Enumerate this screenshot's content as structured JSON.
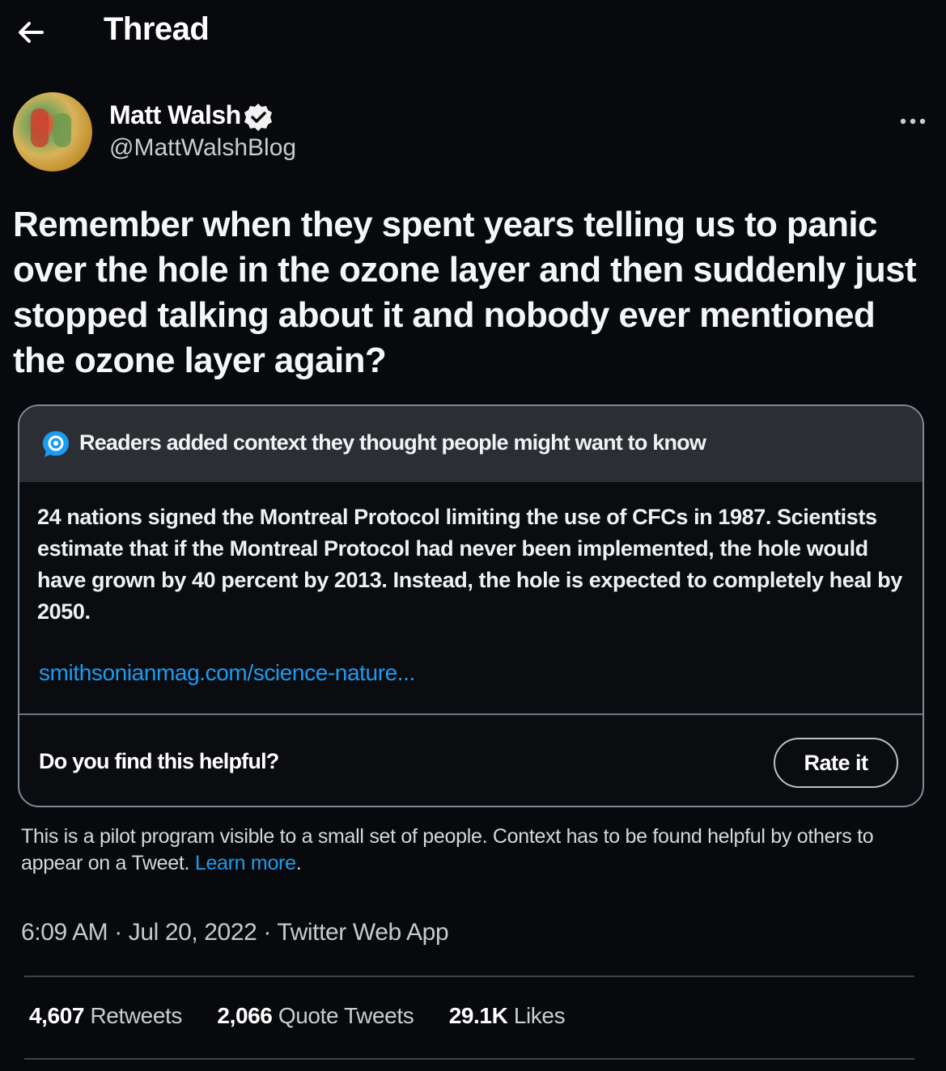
{
  "header": {
    "title": "Thread",
    "back_icon": "arrow-left-icon"
  },
  "author": {
    "name": "Matt Walsh",
    "handle": "@MattWalshBlog",
    "verified_icon": "verified-badge-icon",
    "more_icon": "more-horizontal-icon"
  },
  "tweet": {
    "text": "Remember when they spent years telling us to panic over the hole in the ozone layer and then suddenly just stopped talking about it and nobody ever mentioned the ozone layer again?"
  },
  "context_card": {
    "icon": "community-notes-icon",
    "header": "Readers added context they thought people might want to know",
    "body": "24 nations signed the Montreal Protocol limiting the use of CFCs in 1987. Scientists estimate that if the Montreal Protocol had never been implemented, the hole would have grown by 40 percent by 2013. Instead, the hole is expected to completely heal by 2050.",
    "link": "smithsonianmag.com/science-nature...",
    "helpful_question": "Do you find this helpful?",
    "rate_button": "Rate it"
  },
  "pilot_note": {
    "text": "This is a pilot program visible to a small set of people. Context has to be found helpful by others to appear on a Tweet. ",
    "learn_more": "Learn more",
    "end": "."
  },
  "meta": {
    "time": "6:09 AM",
    "date": "Jul 20, 2022",
    "source": "Twitter Web App",
    "separator": " · "
  },
  "stats": {
    "retweets_count": "4,607",
    "retweets_label": "Retweets",
    "quotes_count": "2,066",
    "quotes_label": "Quote Tweets",
    "likes_count": "29.1K",
    "likes_label": "Likes"
  },
  "colors": {
    "background": "#08090d",
    "accent": "#1d9bf0",
    "card_header": "#2b2f34"
  }
}
